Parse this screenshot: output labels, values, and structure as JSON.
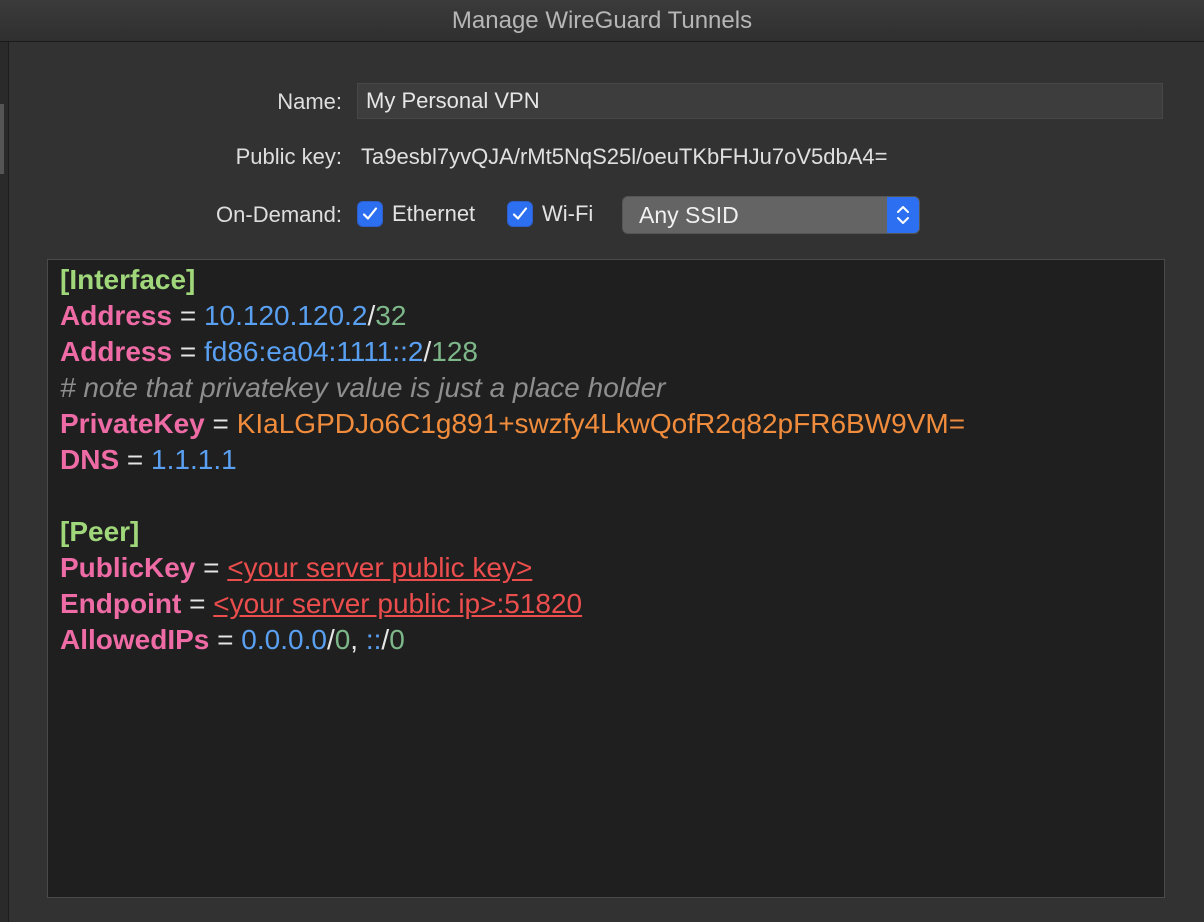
{
  "window": {
    "title": "Manage WireGuard Tunnels"
  },
  "form": {
    "name_label": "Name:",
    "name_value": "My Personal VPN",
    "pubkey_label": "Public key:",
    "pubkey_value": "Ta9esbl7yvQJA/rMt5NqS25l/oeuTKbFHJu7oV5dbA4=",
    "ondemand_label": "On-Demand:",
    "ethernet_label": "Ethernet",
    "ethernet_checked": true,
    "wifi_label": "Wi-Fi",
    "wifi_checked": true,
    "ssid_selected": "Any SSID"
  },
  "config": {
    "interface_header": "[Interface]",
    "addr1_key": "Address",
    "eq": " = ",
    "addr1_ip": "10.120.120.2",
    "slash": "/",
    "addr1_cidr": "32",
    "addr2_key": "Address",
    "addr2_ip": "fd86:ea04:1111::2",
    "addr2_cidr": "128",
    "comment": "# note that privatekey value is just a place holder",
    "privkey_key": "PrivateKey",
    "privkey_value": "KIaLGPDJo6C1g891+swzfy4LkwQofR2q82pFR6BW9VM=",
    "dns_key": "DNS",
    "dns_value": "1.1.1.1",
    "peer_header": "[Peer]",
    "pubkey_key": "PublicKey",
    "pubkey_value": "<your server public key>",
    "endpoint_key": "Endpoint",
    "endpoint_value": "<your server public ip>:51820",
    "allowed_key": "AllowedIPs",
    "allowed_ip1": "0.0.0.0",
    "allowed_cidr1": "0",
    "comma": ", ",
    "allowed_ip2": "::",
    "allowed_cidr2": "0"
  },
  "colors": {
    "section": "#9fd77a",
    "key": "#ee6ba5",
    "ip": "#5aa0f2",
    "cidr": "#7eb88a",
    "comment": "#8e8e8e",
    "private_key": "#f08c3c",
    "error": "#ec4d4d",
    "accent": "#2d6ff1"
  }
}
